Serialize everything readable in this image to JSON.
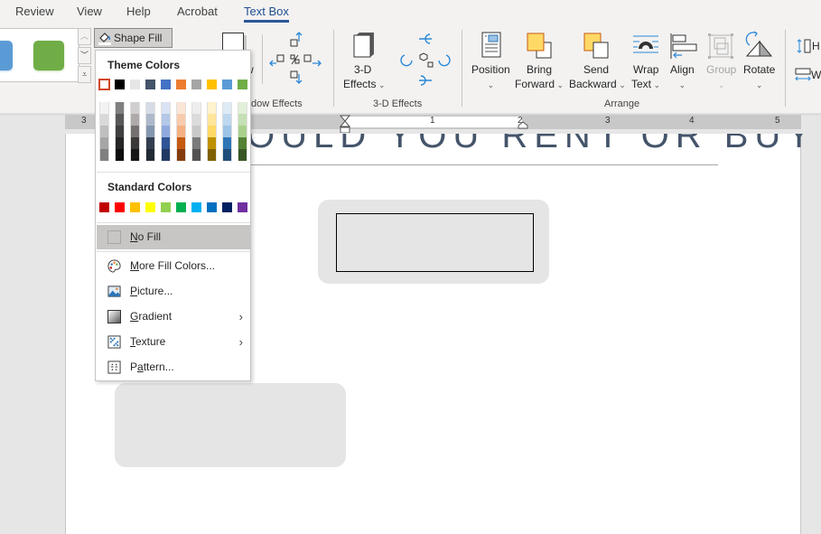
{
  "tabs": [
    {
      "label": "Review",
      "active": false
    },
    {
      "label": "View",
      "active": false
    },
    {
      "label": "Help",
      "active": false
    },
    {
      "label": "Acrobat",
      "active": false
    },
    {
      "label": "Text Box",
      "active": true
    }
  ],
  "ribbon": {
    "shape_fill": {
      "label": "Shape Fill",
      "icon": "paint-bucket-icon"
    },
    "gallery_swatches": [
      "#5b9bd5",
      "#70ad47"
    ],
    "shadow_effects": {
      "button_partial": "w",
      "group_label_partial": "dow Effects"
    },
    "three_d": {
      "label_line1": "3-D",
      "label_line2": "Effects",
      "group_label": "3-D Effects"
    },
    "arrange": {
      "group_label": "Arrange",
      "buttons": [
        {
          "line1": "Position",
          "line2": "",
          "disabled": false
        },
        {
          "line1": "Bring",
          "line2": "Forward",
          "disabled": false
        },
        {
          "line1": "Send",
          "line2": "Backward",
          "disabled": false
        },
        {
          "line1": "Wrap",
          "line2": "Text",
          "disabled": false
        },
        {
          "line1": "Align",
          "line2": "",
          "disabled": false
        },
        {
          "line1": "Group",
          "line2": "",
          "disabled": true
        },
        {
          "line1": "Rotate",
          "line2": "",
          "disabled": false
        }
      ]
    },
    "size": {
      "height_partial": "H",
      "width_partial": "W"
    }
  },
  "shape_fill_menu": {
    "theme_heading": "Theme Colors",
    "theme_colors": [
      "#ffffff",
      "#000000",
      "#e7e6e6",
      "#44546a",
      "#4472c4",
      "#ed7d31",
      "#a5a5a5",
      "#ffc000",
      "#5b9bd5",
      "#70ad47"
    ],
    "theme_shades": [
      [
        "#f2f2f2",
        "#d9d9d9",
        "#bfbfbf",
        "#a6a6a6",
        "#808080"
      ],
      [
        "#808080",
        "#595959",
        "#404040",
        "#262626",
        "#0d0d0d"
      ],
      [
        "#d0cece",
        "#aeaaaa",
        "#767171",
        "#3b3838",
        "#171616"
      ],
      [
        "#d6dce5",
        "#adb9ca",
        "#8497b0",
        "#333f50",
        "#222a35"
      ],
      [
        "#dae3f3",
        "#b4c7e7",
        "#8faadc",
        "#2f5597",
        "#203864"
      ],
      [
        "#fbe5d6",
        "#f8cbad",
        "#f4b183",
        "#c55a11",
        "#843c0c"
      ],
      [
        "#ededed",
        "#dbdbdb",
        "#c9c9c9",
        "#7b7b7b",
        "#525252"
      ],
      [
        "#fff2cc",
        "#ffe699",
        "#ffd966",
        "#bf9000",
        "#7f6000"
      ],
      [
        "#deebf7",
        "#bdd7ee",
        "#9dc3e6",
        "#2e75b6",
        "#1f4e79"
      ],
      [
        "#e2f0d9",
        "#c5e0b4",
        "#a9d18e",
        "#548235",
        "#385723"
      ]
    ],
    "standard_heading": "Standard Colors",
    "standard_colors": [
      "#c00000",
      "#ff0000",
      "#ffc000",
      "#ffff00",
      "#92d050",
      "#00b050",
      "#00b0f0",
      "#0070c0",
      "#002060",
      "#7030a0"
    ],
    "selected_theme_index": 0,
    "items": [
      {
        "label": "No Fill",
        "icon": "no-fill-icon",
        "submenu": false,
        "highlighted": true
      },
      {
        "label": "More Fill Colors...",
        "icon": "palette-icon",
        "submenu": false,
        "highlighted": false
      },
      {
        "label": "Picture...",
        "icon": "picture-icon",
        "submenu": false,
        "highlighted": false
      },
      {
        "label": "Gradient",
        "icon": "gradient-icon",
        "submenu": true,
        "highlighted": false
      },
      {
        "label": "Texture",
        "icon": "texture-icon",
        "submenu": true,
        "highlighted": false
      },
      {
        "label": "Pattern...",
        "icon": "pattern-icon",
        "submenu": false,
        "highlighted": false
      }
    ]
  },
  "ruler": {
    "labels": [
      "3",
      "1",
      "1",
      "2",
      "3",
      "4",
      "5"
    ]
  },
  "document": {
    "title_visible": "OULD YOU RENT OR BUY?",
    "shape_fill_color": "#e6e5e6"
  }
}
